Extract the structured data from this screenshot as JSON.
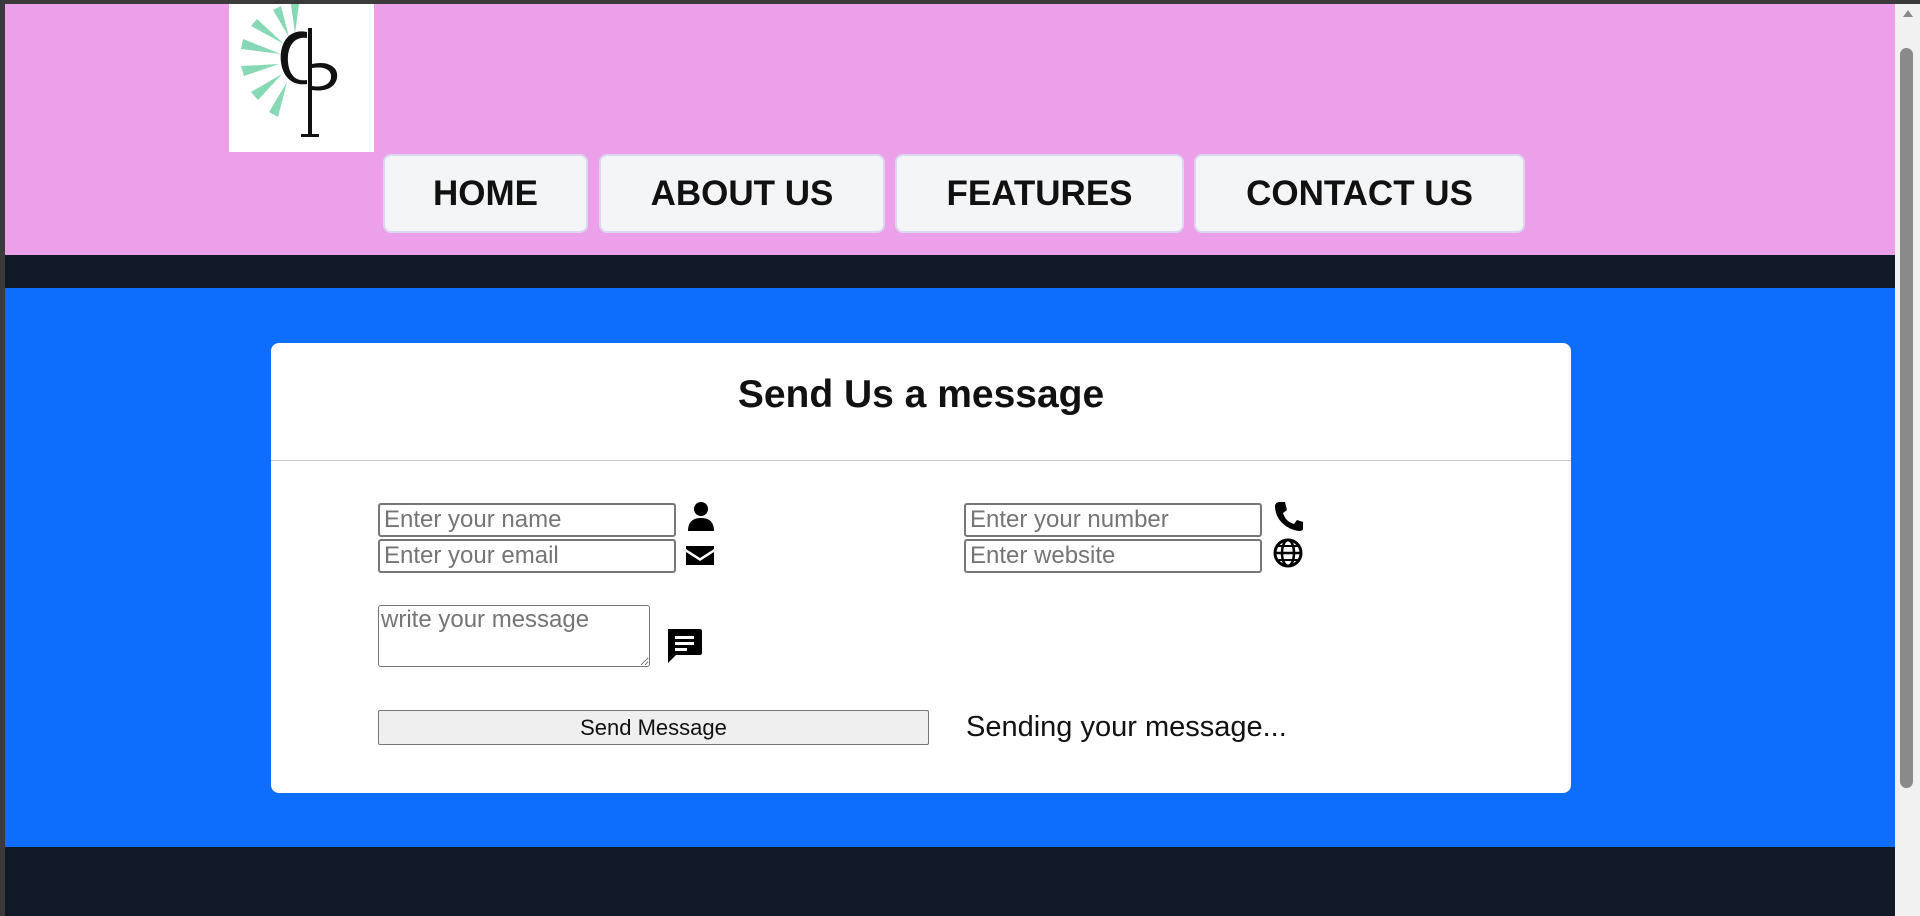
{
  "logo": {
    "alt": "CP logo",
    "letters": "CP",
    "accent_color": "#86d9b4"
  },
  "nav": {
    "items": [
      {
        "label": "HOME"
      },
      {
        "label": "ABOUT US"
      },
      {
        "label": "FEATURES"
      },
      {
        "label": "CONTACT US"
      }
    ]
  },
  "colors": {
    "header_bg": "#eca0e9",
    "main_bg": "#0d6efd",
    "dark_band": "#111827",
    "card_bg": "#ffffff"
  },
  "form": {
    "title": "Send Us a message",
    "name_placeholder": "Enter your name",
    "email_placeholder": "Enter your email",
    "number_placeholder": "Enter your number",
    "website_placeholder": "Enter website",
    "message_placeholder": "write your message",
    "submit_label": "Send Message",
    "status_text": "Sending your message..."
  },
  "icons": {
    "name": "user-icon",
    "email": "envelope-icon",
    "number": "phone-icon",
    "website": "globe-icon",
    "message": "message-icon"
  }
}
